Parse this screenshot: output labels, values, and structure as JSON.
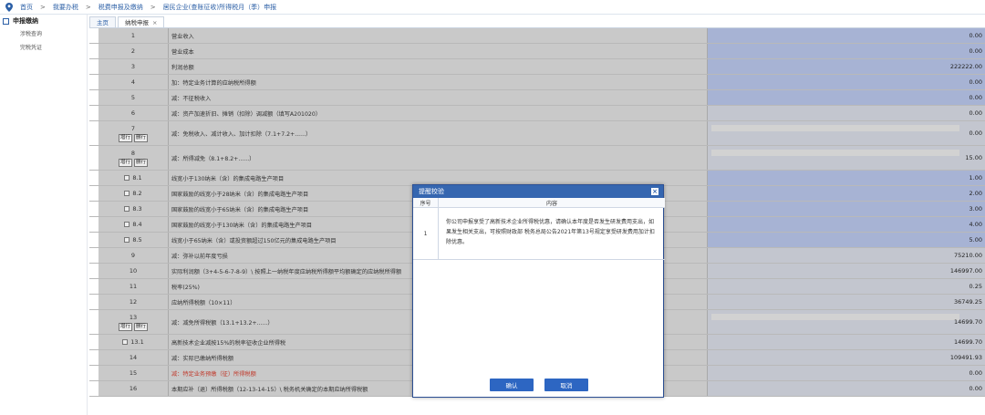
{
  "breadcrumb": [
    "首页",
    "我要办税",
    "税费申报及缴纳",
    "居民企业(查账征收)所得税月（季）申报"
  ],
  "sidebar": {
    "title": "申报缴纳",
    "items": [
      "涉税查询",
      "完税凭证"
    ]
  },
  "tabs": [
    {
      "label": "主页",
      "active": false
    },
    {
      "label": "纳税申报",
      "active": true,
      "close": "×"
    }
  ],
  "rows": [
    {
      "no": "1",
      "name": "营业收入",
      "value": "0.00",
      "blue": true
    },
    {
      "no": "2",
      "name": "营业成本",
      "value": "0.00",
      "blue": true
    },
    {
      "no": "3",
      "name": "利润总额",
      "value": "222222.00",
      "blue": true
    },
    {
      "no": "4",
      "name": "加：特定业务计算的应纳税所得额",
      "value": "0.00",
      "blue": true
    },
    {
      "no": "5",
      "name": "减：不征税收入",
      "value": "0.00",
      "blue": true
    },
    {
      "no": "6",
      "name": "减：资产加速折旧、摊销（扣除）调减额（填写A201020）",
      "value": "0.00",
      "blue": false
    },
    {
      "no": "7",
      "name": "减：免税收入、减计收入、加计扣除（7.1+7.2+......）",
      "value": "0.00",
      "blue": false,
      "buttons": [
        "增行",
        "删行"
      ]
    },
    {
      "no": "8",
      "name": "减：所得减免（8.1+8.2+......）",
      "value": "15.00",
      "blue": false,
      "buttons": [
        "增行",
        "删行"
      ]
    },
    {
      "no": "8.1",
      "name": "线宽小于130纳米（含）的集成电路生产项目",
      "value": "1.00",
      "blue": true,
      "check": true
    },
    {
      "no": "8.2",
      "name": "国家鼓励的线宽小于28纳米（含）的集成电路生产项目",
      "value": "2.00",
      "blue": true,
      "check": true
    },
    {
      "no": "8.3",
      "name": "国家鼓励的线宽小于65纳米（含）的集成电路生产项目",
      "value": "3.00",
      "blue": true,
      "check": true
    },
    {
      "no": "8.4",
      "name": "国家鼓励的线宽小于130纳米（含）的集成电路生产项目",
      "value": "4.00",
      "blue": true,
      "check": true
    },
    {
      "no": "8.5",
      "name": "线宽小于65纳米（含）或投资额超过150亿元的集成电路生产项目",
      "value": "5.00",
      "blue": true,
      "check": true
    },
    {
      "no": "9",
      "name": "减：弥补以前年度亏损",
      "value": "75210.00",
      "blue": false
    },
    {
      "no": "10",
      "name": "实际利润额（3+4-5-6-7-8-9）\\ 按照上一纳税年度应纳税所得额平均额确定的应纳税所得额",
      "value": "146997.00",
      "blue": false
    },
    {
      "no": "11",
      "name": "税率(25%)",
      "value": "0.25",
      "blue": false
    },
    {
      "no": "12",
      "name": "应纳所得税额（10×11）",
      "value": "36749.25",
      "blue": false
    },
    {
      "no": "13",
      "name": "减：减免所得税额（13.1+13.2+......）",
      "value": "14699.70",
      "blue": false,
      "buttons": [
        "增行",
        "删行"
      ]
    },
    {
      "no": "13.1",
      "name": "高新技术企业减按15%的税率征收企业所得税",
      "value": "14699.70",
      "blue": false,
      "check": true
    },
    {
      "no": "14",
      "name": "减：实际已缴纳所得税额",
      "value": "109491.93",
      "blue": false
    },
    {
      "no": "15",
      "name": "减：特定业务预缴（征）所得税额",
      "value": "0.00",
      "blue": false,
      "red": true
    },
    {
      "no": "16",
      "name": "本期应补（退）所得税额（12-13-14-15）\\ 税务机关确定的本期应纳所得税额",
      "value": "0.00",
      "blue": false
    }
  ],
  "dialog": {
    "title": "提醒校验",
    "close": "×",
    "col_no": "序号",
    "col_content": "内容",
    "items": [
      {
        "no": "1",
        "text": "你公司申报享受了高新技术企业所得税优惠，请确认本年度是否发生研发费用支出，如果发生相关支出，可按照财政部 税务总局公告2021年第13号规定享受研发费用加计扣除优惠。"
      }
    ],
    "confirm": "确认",
    "cancel": "取消"
  },
  "colors": {
    "accent": "#3566b0",
    "blue_cell": "#a7b3d4",
    "gray_cell": "#c9c9c9"
  }
}
